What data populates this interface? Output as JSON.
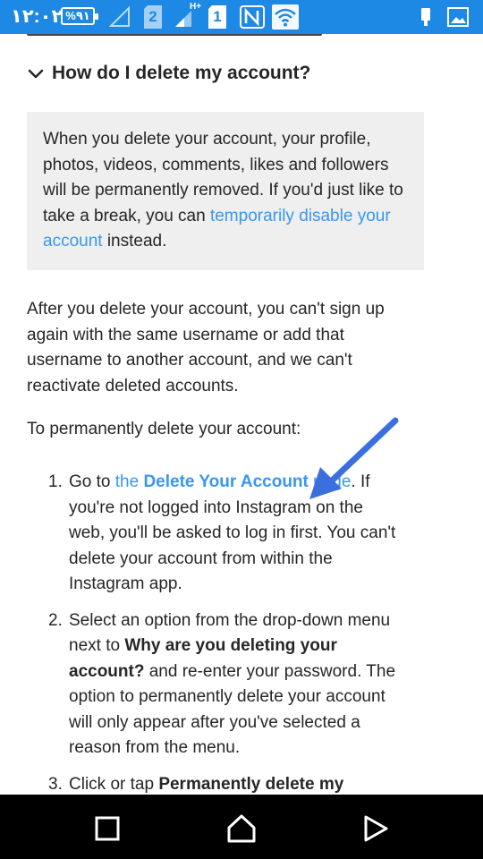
{
  "status_bar": {
    "time": "١٢:٠٢",
    "battery": "%٩١",
    "sim_badge": "2",
    "network_type": "H+",
    "sim_slot": "1",
    "icons": [
      "battery-icon",
      "signal-empty-icon",
      "sim2-icon",
      "signal-hplus-icon",
      "sim1-icon",
      "nfc-icon",
      "wifi-icon",
      "usb-icon",
      "image-icon"
    ]
  },
  "faq": {
    "title": "How do I delete my account?",
    "note": {
      "text_before": "When you delete your account, your profile, photos, videos, comments, likes and followers will be permanently removed. If you'd just like to take a break, you can ",
      "link": "temporarily disable your account",
      "text_after": " instead."
    },
    "paragraph1": "After you delete your account, you can't sign up again with the same username or add that username to another account, and we can't reactivate deleted accounts.",
    "paragraph2": "To permanently delete your account:",
    "steps": [
      {
        "num": "1.",
        "pre": "Go to ",
        "link_pre": "the ",
        "link_bold": "Delete Your Account",
        "link_post": " page",
        "rest": ". If you're not logged into Instagram on the web, you'll be asked to log in first. You can't delete your account from within the Instagram app."
      },
      {
        "num": "2.",
        "pre": "Select an option from the drop-down menu next to ",
        "bold": "Why are you deleting your account?",
        "rest": " and re-enter your password. The option to permanently delete your account will only appear after you've selected a reason from the menu."
      },
      {
        "num": "3.",
        "pre": "Click or tap ",
        "bold": "Permanently delete my"
      }
    ]
  },
  "nav_bar": {
    "buttons": [
      "recents-square-icon",
      "home-icon",
      "back-play-icon"
    ]
  },
  "colors": {
    "status_bar": "#1e88e5",
    "link": "#3897f0",
    "note_background": "#efefef",
    "arrow": "#3b6fe0"
  }
}
